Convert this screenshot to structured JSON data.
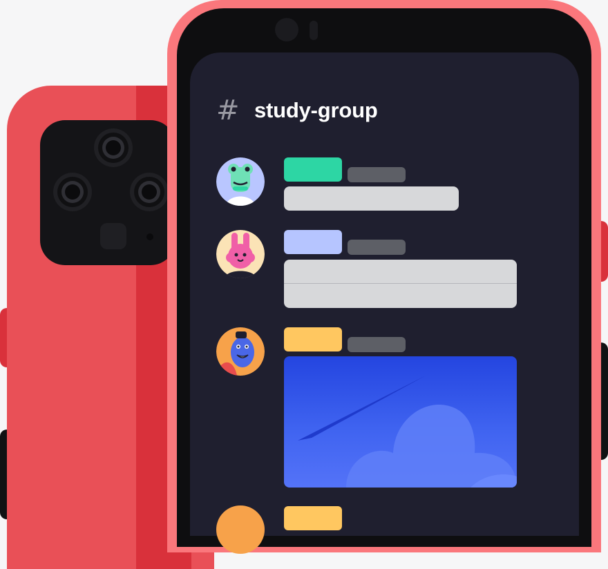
{
  "channel": {
    "hash_symbol": "#",
    "name": "study-group"
  },
  "colors": {
    "back_phone": "#e95057",
    "front_phone_frame": "#fa777c",
    "screen_background": "#1f1f2f",
    "username_green": "#2dd6a4",
    "username_lavender": "#b6c5ff",
    "username_yellow": "#ffc760",
    "timestamp_pill": "#5d5f66",
    "message_bubble": "#d7d8da",
    "image_blue": "#2e4fe6"
  },
  "messages": [
    {
      "avatar": "frog-avatar-icon",
      "username_color": "#2dd6a4",
      "content": "text"
    },
    {
      "avatar": "bunny-avatar-icon",
      "username_color": "#b6c5ff",
      "content": "text"
    },
    {
      "avatar": "genie-avatar-icon",
      "username_color": "#ffc760",
      "content": "image"
    },
    {
      "avatar": "avatar-icon",
      "username_color": "#ffc760",
      "content": "partial"
    }
  ]
}
